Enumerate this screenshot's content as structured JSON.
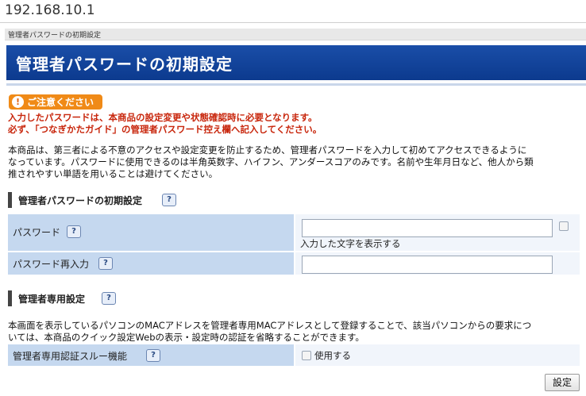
{
  "address_bar": {
    "url": "192.168.10.1"
  },
  "breadcrumb": "管理者パスワードの初期設定",
  "page_title": "管理者パスワードの初期設定",
  "notice": {
    "badge_label": "ご注意ください",
    "line1": "入力したパスワードは、本商品の設定変更や状態確認時に必要となります。",
    "line2": "必ず、「つなぎかたガイド」の管理者パスワード控え欄へ記入してください。"
  },
  "intro": {
    "line1": "本商品は、第三者による不意のアクセスや設定変更を防止するため、管理者パスワードを入力して初めてアクセスできるように",
    "line2": "なっています。パスワードに使用できるのは半角英数字、ハイフン、アンダースコアのみです。名前や生年月日など、他人から類",
    "line3": "推されやすい単語を用いることは避けてください。"
  },
  "section_password": {
    "title": "管理者パスワードの初期設定",
    "help": "?",
    "rows": {
      "password_label": "パスワード",
      "password_value": "",
      "show_chars_label": "入力した文字を表示する",
      "password_confirm_label": "パスワード再入力",
      "password_confirm_value": ""
    }
  },
  "section_admin": {
    "title": "管理者専用設定",
    "help": "?",
    "desc_line1": "本画面を表示しているパソコンのMACアドレスを管理者専用MACアドレスとして登録することで、該当パソコンからの要求につ",
    "desc_line2": "いては、本商品のクイック設定Webの表示・設定時の認証を省略することができます。",
    "bypass_label": "管理者専用認証スルー機能",
    "use_label": "使用する"
  },
  "submit_label": "設定",
  "colors": {
    "banner": "#0c3a8e",
    "notice_badge": "#f08a17",
    "warn_text": "#c8260c",
    "label_cell": "#c5d8ef"
  }
}
